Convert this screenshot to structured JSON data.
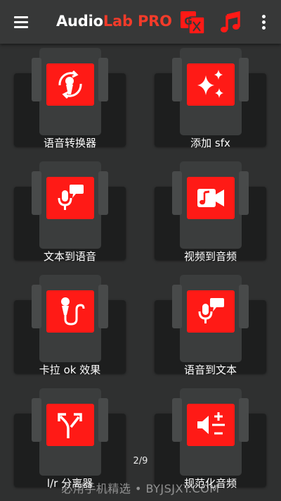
{
  "app": {
    "title_part1": "Audio",
    "title_part2": "Lab PRO",
    "accent_color": "#ff1a16",
    "title_red": "#f23b2a"
  },
  "toolbar": {
    "menu_icon": "hamburger-menu-icon",
    "translate_icon": "translate-icon",
    "music_icon": "music-note-icon",
    "more_icon": "more-vert-icon"
  },
  "features": [
    {
      "label": "语音转换器",
      "icon": "voice-changer-icon"
    },
    {
      "label": "添加 sfx",
      "icon": "sparkles-icon"
    },
    {
      "label": "文本到语音",
      "icon": "mic-speech-bubble-icon"
    },
    {
      "label": "视频到音频",
      "icon": "video-camera-music-icon"
    },
    {
      "label": "卡拉 ok 效果",
      "icon": "karaoke-mic-icon"
    },
    {
      "label": "语音到文本",
      "icon": "mic-speech-bubble-icon"
    },
    {
      "label": "l/r 分离器",
      "icon": "split-arrows-icon"
    },
    {
      "label": "规范化音频",
      "icon": "volume-plus-minus-icon"
    }
  ],
  "pager": {
    "text": "2/9"
  },
  "watermark": {
    "text": "必用手机精选 • BYJSJXY.COM"
  }
}
